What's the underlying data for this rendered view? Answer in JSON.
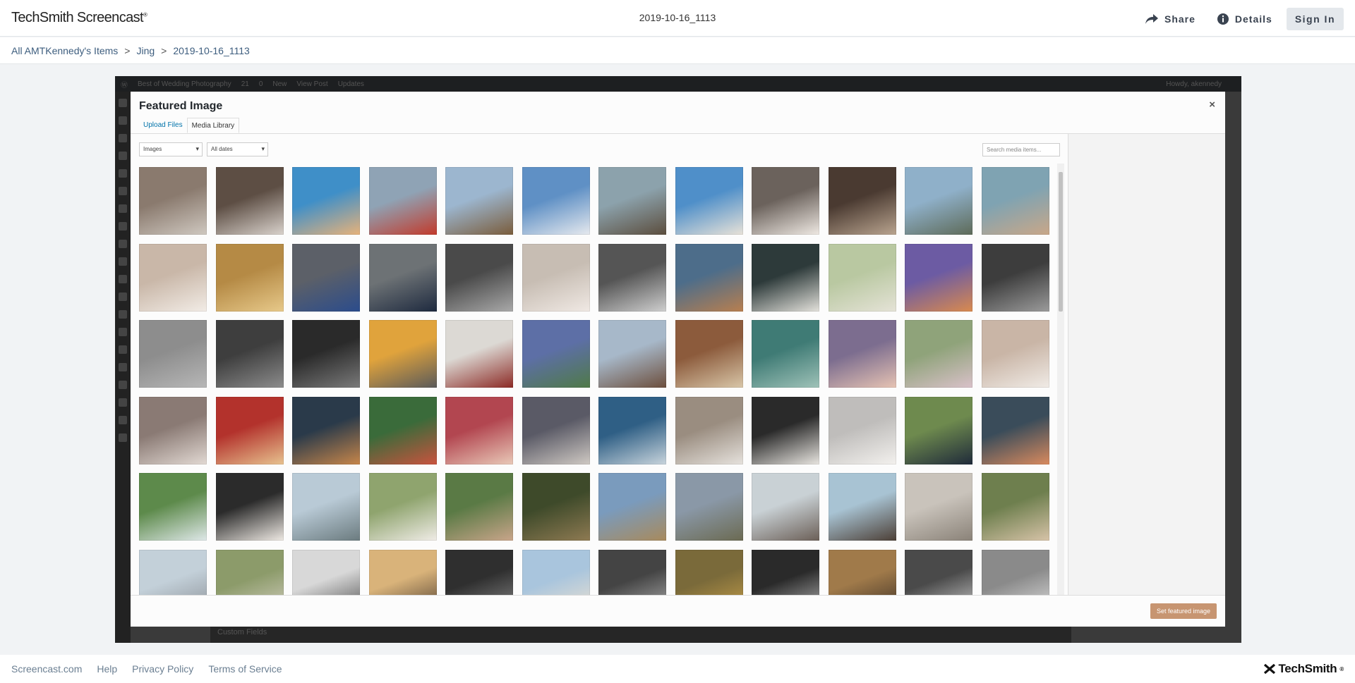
{
  "header": {
    "logo": "TechSmith Screencast",
    "logo_mark": "®",
    "title": "2019-10-16_1113",
    "share_label": "Share",
    "details_label": "Details",
    "signin_label": "Sign In"
  },
  "breadcrumb": {
    "items": [
      "All AMTKennedy's Items",
      "Jing",
      "2019-10-16_1113"
    ],
    "separator": ">"
  },
  "wp": {
    "site": "Best of Wedding Photography",
    "updates_count": "21",
    "comments_count": "0",
    "new_label": "New",
    "view_post": "View Post",
    "updates_label": "Updates",
    "howdy": "Howdy, akennedy",
    "custom_fields": "Custom Fields"
  },
  "modal": {
    "title": "Featured Image",
    "close": "×",
    "tabs": [
      "Upload Files",
      "Media Library"
    ],
    "filter_type": "Images",
    "filter_date": "All dates",
    "search_placeholder": "Search media items...",
    "set_button": "Set featured image",
    "thumbnails": [
      [
        "#8a7a6e",
        "#cfc8c0"
      ],
      [
        "#5d4e44",
        "#d9d2cc"
      ],
      [
        "#3f8fc8",
        "#e7b27a"
      ],
      [
        "#8fa3b5",
        "#c23a2b"
      ],
      [
        "#9cb6cf",
        "#7a5c3b"
      ],
      [
        "#5f90c5",
        "#e6e9ee"
      ],
      [
        "#8ca2ac",
        "#5b4d3d"
      ],
      [
        "#4f8fc9",
        "#e8e2d8"
      ],
      [
        "#6b625c",
        "#efe9e3"
      ],
      [
        "#4a3a31",
        "#b9a48f"
      ],
      [
        "#8fb0c9",
        "#5d6a58"
      ],
      [
        "#7fa3b2",
        "#c9a788"
      ],
      [
        "#c9b7a8",
        "#f2ece6"
      ],
      [
        "#b58a45",
        "#e7c98a"
      ],
      [
        "#5c6068",
        "#2b4c8c"
      ],
      [
        "#6d7275",
        "#1e2a3f"
      ],
      [
        "#4a4a4a",
        "#a9a9a9"
      ],
      [
        "#c7bdb3",
        "#f0e9e4"
      ],
      [
        "#555555",
        "#cfcfcf"
      ],
      [
        "#4d6d8a",
        "#b87f4f"
      ],
      [
        "#2d3a3a",
        "#e4e2dc"
      ],
      [
        "#b9c8a1",
        "#e5e3d7"
      ],
      [
        "#6c5ba3",
        "#d98a4e"
      ],
      [
        "#3d3d3d",
        "#9b9b9b"
      ],
      [
        "#8d8d8d",
        "#b7b7b7"
      ],
      [
        "#3e3e3e",
        "#8c8c8c"
      ],
      [
        "#2a2a2a",
        "#7a7a7a"
      ],
      [
        "#e0a33c",
        "#5a5a5a"
      ],
      [
        "#dcd9d4",
        "#8c2a25"
      ],
      [
        "#5d6fa6",
        "#4f7a48"
      ],
      [
        "#a7b8c9",
        "#6c4e3c"
      ],
      [
        "#8c5b3c",
        "#d8c6a8"
      ],
      [
        "#3f7b75",
        "#9fc2b8"
      ],
      [
        "#7c6d8f",
        "#e6c3b3"
      ],
      [
        "#8fa37a",
        "#d9c1c9"
      ],
      [
        "#c9b5a6",
        "#f0ebe6"
      ],
      [
        "#8a7a74",
        "#e2d9d3"
      ],
      [
        "#b3322c",
        "#e7c28f"
      ],
      [
        "#2a3a4a",
        "#c7864a"
      ],
      [
        "#3a6b3a",
        "#c9533e"
      ],
      [
        "#b24650",
        "#e9c9b8"
      ],
      [
        "#5a5a66",
        "#cfc9c3"
      ],
      [
        "#2f5f85",
        "#c8d4dc"
      ],
      [
        "#9a8d80",
        "#e6e2dd"
      ],
      [
        "#2a2a2a",
        "#e9e6e1"
      ],
      [
        "#bfbdbb",
        "#f3f1ee"
      ],
      [
        "#6e8a4e",
        "#1f2a3a"
      ],
      [
        "#3a4c5a",
        "#d98a5e"
      ],
      [
        "#5d8a4b",
        "#dfe8e9"
      ],
      [
        "#2b2b2b",
        "#efeae4"
      ],
      [
        "#b9cad6",
        "#6b7b7f"
      ],
      [
        "#8fa46e",
        "#f0ece7"
      ],
      [
        "#5a7a45",
        "#c9a58a"
      ],
      [
        "#3e4a2a",
        "#8e7a52"
      ],
      [
        "#7a9bbd",
        "#a88a5c"
      ],
      [
        "#8a98a7",
        "#6b6a52"
      ],
      [
        "#c9d1d5",
        "#6b5f57"
      ],
      [
        "#a8c3d3",
        "#4c3f36"
      ],
      [
        "#c9c3bb",
        "#8a8278"
      ],
      [
        "#6e7f4e",
        "#d7c3a8"
      ],
      [
        "#c3d0d9",
        "#8a8f95"
      ],
      [
        "#8c9b6a",
        "#d6d0c4"
      ],
      [
        "#d8d8d8",
        "#4a4a4a"
      ],
      [
        "#d9b37a",
        "#4a3a2e"
      ],
      [
        "#2f2f2f",
        "#8a8a8a"
      ],
      [
        "#a9c5dd",
        "#f0e3d0"
      ],
      [
        "#444444",
        "#b3b3b3"
      ],
      [
        "#7a6a3a",
        "#c9a14a"
      ],
      [
        "#2a2a2a",
        "#bdbdbd"
      ],
      [
        "#a07a4a",
        "#3a2e25"
      ],
      [
        "#4a4a4a",
        "#d2d2d2"
      ],
      [
        "#8a8a8a",
        "#e2e2e2"
      ]
    ]
  },
  "footer": {
    "links": [
      "Screencast.com",
      "Help",
      "Privacy Policy",
      "Terms of Service"
    ],
    "brand": "TechSmith",
    "brand_mark": "®"
  },
  "icons": {
    "share": "share-arrow-icon",
    "details": "info-circle-icon",
    "close": "close-icon",
    "techsmith": "techsmith-logo-icon"
  }
}
